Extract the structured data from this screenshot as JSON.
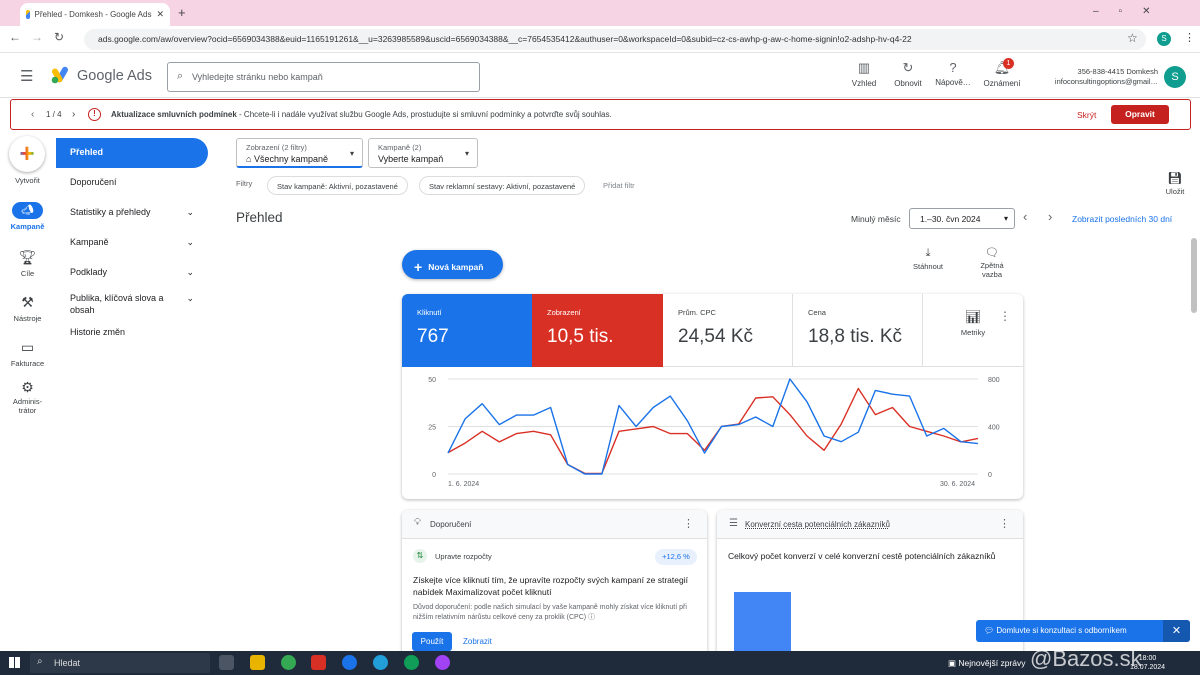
{
  "browser": {
    "tab_title": "Přehled - Domkesh - Google Ads",
    "url": "ads.google.com/aw/overview?ocid=6569034388&euid=1165191261&__u=3263985589&uscid=6569034388&__c=7654535412&authuser=0&workspaceId=0&subid=cz-cs-awhp-g-aw-c-home-signin!o2-adshp-hv-q4-22",
    "profile_initial": "S"
  },
  "header": {
    "logo_text": "Google Ads",
    "search_placeholder": "Vyhledejte stránku nebo kampaň",
    "actions": [
      {
        "label": "Vzhled",
        "icon": "layout-icon"
      },
      {
        "label": "Obnovit",
        "icon": "refresh-icon"
      },
      {
        "label": "Nápově…",
        "icon": "help-icon"
      },
      {
        "label": "Oznámení",
        "icon": "bell-icon",
        "badge": "1"
      }
    ],
    "account_id": "356-838-4415 Domkesh",
    "account_email": "infoconsultingoptions@gmail…",
    "avatar": "S"
  },
  "banner": {
    "pager": "1 / 4",
    "title": "Aktualizace smluvních podmínek",
    "text": " - Chcete-li i nadále využívat službu Google Ads, prostudujte si smluvní podmínky a potvrďte svůj souhlas.",
    "hide": "Skrýt",
    "fix": "Opravit"
  },
  "rail": [
    {
      "label": "Vytvořit"
    },
    {
      "label": "Kampaně"
    },
    {
      "label": "Cíle"
    },
    {
      "label": "Nástroje"
    },
    {
      "label": "Fakturace"
    },
    {
      "label": "Adminis-\ntrátor"
    }
  ],
  "sidenav": [
    {
      "label": "Přehled"
    },
    {
      "label": "Doporučení"
    },
    {
      "label": "Statistiky a přehledy"
    },
    {
      "label": "Kampaně"
    },
    {
      "label": "Podklady"
    },
    {
      "label": "Publika, klíčová slova a obsah"
    },
    {
      "label": "Historie změn"
    }
  ],
  "filters": {
    "view_label": "Zobrazení (2 filtry)",
    "view_value": "Všechny kampaně",
    "camp_label": "Kampaně (2)",
    "camp_value": "Vyberte kampaň",
    "filters_label": "Filtry",
    "chip1": "Stav kampaně: Aktivní, pozastavené",
    "chip2": "Stav reklamní sestavy: Aktivní, pozastavené",
    "add": "Přidat filtr",
    "save": "Uložit"
  },
  "overview": {
    "title": "Přehled",
    "period_label": "Minulý měsíc",
    "period_value": "1.–30. čvn 2024",
    "last30": "Zobrazit posledních 30 dní",
    "new_campaign": "Nová kampaň",
    "download": "Stáhnout",
    "feedback": "Zpětná vazba"
  },
  "kpis": [
    {
      "label": "Kliknutí",
      "value": "767",
      "color": "#1a73e8"
    },
    {
      "label": "Zobrazení",
      "value": "10,5 tis.",
      "color": "#d93025"
    },
    {
      "label": "Prům. CPC",
      "value": "24,54 Kč"
    },
    {
      "label": "Cena",
      "value": "18,8 tis. Kč"
    }
  ],
  "metrics_label": "Metriky",
  "chart_data": {
    "type": "line",
    "x_start_label": "1. 6. 2024",
    "x_end_label": "30. 6. 2024",
    "left_ticks": [
      "50",
      "25",
      "0"
    ],
    "right_ticks": [
      "800",
      "400",
      "0"
    ],
    "left_ylim": [
      0,
      50
    ],
    "right_ylim": [
      0,
      800
    ],
    "series": [
      {
        "color": "#1a73e8",
        "axis": "left",
        "values": [
          11,
          29,
          37,
          26,
          31,
          31,
          35,
          5,
          0,
          0,
          36,
          25,
          35,
          41,
          28,
          11,
          25,
          26,
          30,
          25,
          50,
          38,
          20,
          17,
          22,
          44,
          42,
          41,
          20,
          24,
          17,
          16
        ]
      },
      {
        "color": "#d93025",
        "axis": "right",
        "values": [
          180,
          260,
          360,
          270,
          340,
          360,
          330,
          80,
          5,
          5,
          360,
          380,
          400,
          340,
          340,
          200,
          400,
          420,
          640,
          650,
          500,
          320,
          200,
          420,
          720,
          500,
          560,
          400,
          360,
          320,
          270,
          300
        ]
      }
    ]
  },
  "reco": {
    "title": "Doporučení",
    "item_label": "Upravte rozpočty",
    "badge": "+12,6 %",
    "headline": "Získejte více kliknutí tím, že upravíte rozpočty svých kampaní ze strategií nabídek Maximalizovat počet kliknutí",
    "reason": "Důvod doporučení: podle našich simulací by vaše kampaně mohly získat více kliknutí při nižším relativním nárůstu celkové ceny za proklik (CPC)",
    "apply": "Použít",
    "view": "Zobrazit"
  },
  "conversion": {
    "title": "Konverzní cesta potenciálních zákazníků",
    "subtitle": "Celkový počet konverzí v celé konverzní cestě potenciálních zákazníků",
    "bar_fill": 1.0
  },
  "toast": "Domluvte si konzultaci s odborníkem",
  "taskbar": {
    "search": "Hledat",
    "news": "Nejnovější zprávy",
    "time": "18:00",
    "date": "18.07.2024",
    "watermark": "@Bazos.sk"
  }
}
